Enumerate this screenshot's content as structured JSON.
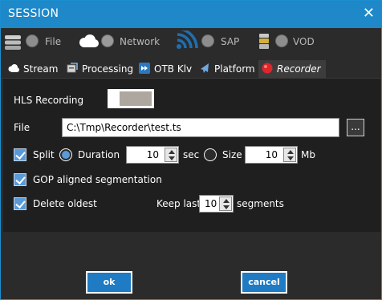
{
  "window": {
    "title": "SESSION",
    "close_glyph": "✕"
  },
  "sources": [
    {
      "label": "File",
      "icon": "database-icon"
    },
    {
      "label": "Network",
      "icon": "cloud-icon"
    },
    {
      "label": "SAP",
      "icon": "broadcast-icon"
    },
    {
      "label": "VOD",
      "icon": "vod-icon"
    }
  ],
  "tabs": [
    {
      "label": "Stream",
      "icon": "cloud-icon"
    },
    {
      "label": "Processing",
      "icon": "processing-icon"
    },
    {
      "label": "OTB Klv",
      "icon": "klv-icon"
    },
    {
      "label": "Platform",
      "icon": "plane-icon"
    },
    {
      "label": "Recorder",
      "icon": "record-icon",
      "active": true
    }
  ],
  "recorder": {
    "hls_label": "HLS Recording",
    "file_label": "File",
    "file_value": "C:\\Tmp\\Recorder\\test.ts",
    "browse_label": "...",
    "split_label": "Split",
    "duration_label": "Duration",
    "duration_value": "10",
    "duration_unit": "sec",
    "size_label": "Size",
    "size_value": "10",
    "size_unit": "Mb",
    "gop_label": "GOP aligned segmentation",
    "delete_label": "Delete oldest",
    "keep_label": "Keep last",
    "keep_value": "10",
    "segments_label": "segments"
  },
  "buttons": {
    "ok": "ok",
    "cancel": "cancel"
  },
  "colors": {
    "accent": "#1e88c8",
    "checkbox": "#5a9ad8",
    "record": "#e0242a"
  }
}
